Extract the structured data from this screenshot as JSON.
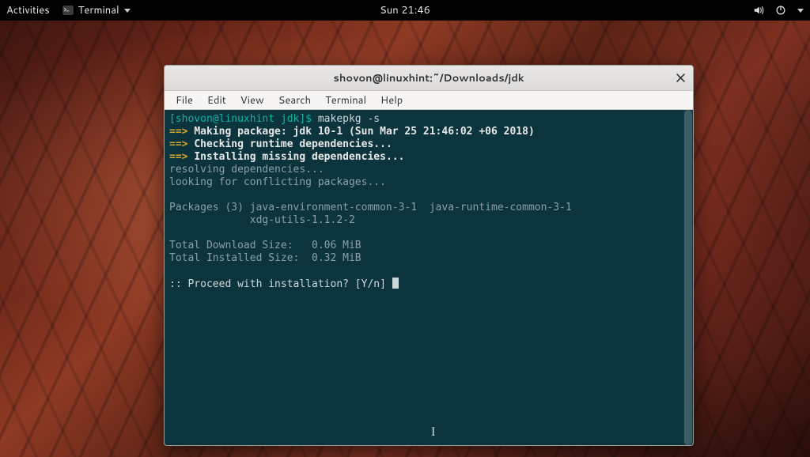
{
  "topbar": {
    "activities": "Activities",
    "app_name": "Terminal",
    "clock": "Sun 21:46"
  },
  "window": {
    "title": "shovon@linuxhint:~/Downloads/jdk"
  },
  "menubar": {
    "file": "File",
    "edit": "Edit",
    "view": "View",
    "search": "Search",
    "terminal": "Terminal",
    "help": "Help"
  },
  "term": {
    "prompt_user_host": "[shovon@linuxhint jdk]$ ",
    "command": "makepkg -s",
    "arrow": "==> ",
    "line_making": "Making package: jdk 10-1 (Sun Mar 25 21:46:02 +06 2018)",
    "line_checking": "Checking runtime dependencies...",
    "line_installing": "Installing missing dependencies...",
    "resolving": "resolving dependencies...",
    "conflict": "looking for conflicting packages...",
    "packages": "Packages (3) java-environment-common-3-1  java-runtime-common-3-1",
    "packages2": "             xdg-utils-1.1.2-2",
    "dl_size": "Total Download Size:   0.06 MiB",
    "inst_size": "Total Installed Size:  0.32 MiB",
    "proceed": ":: Proceed with installation? [Y/n] "
  }
}
